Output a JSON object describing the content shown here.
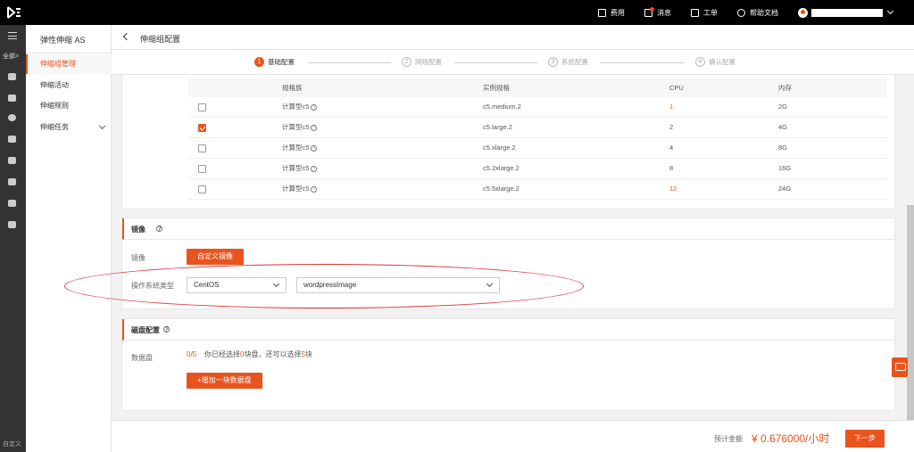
{
  "topbar": {
    "items": [
      {
        "label": "费用",
        "icon": "fee-icon"
      },
      {
        "label": "消息",
        "icon": "message-icon"
      },
      {
        "label": "工单",
        "icon": "ticket-icon"
      },
      {
        "label": "帮助文档",
        "icon": "help-icon"
      }
    ]
  },
  "rail": {
    "all_label": "全部",
    "custom_label": "自定义"
  },
  "subnav": {
    "title": "弹性伸缩 AS",
    "items": [
      {
        "label": "伸缩组管理"
      },
      {
        "label": "伸缩活动"
      },
      {
        "label": "伸缩规则"
      },
      {
        "label": "伸缩任务"
      }
    ]
  },
  "header": {
    "title": "伸缩组配置"
  },
  "steps": [
    {
      "num": "1",
      "label": "基础配置"
    },
    {
      "num": "2",
      "label": "网络配置"
    },
    {
      "num": "3",
      "label": "系统配置"
    },
    {
      "num": "4",
      "label": "确认配置"
    }
  ],
  "spec_table": {
    "headers": [
      "规格族",
      "实例规格",
      "CPU",
      "内存"
    ],
    "rows": [
      {
        "family": "计算型c5",
        "spec": "c5.medium.2",
        "cpu": "1",
        "mem": "2G",
        "checked": false
      },
      {
        "family": "计算型c5",
        "spec": "c5.large.2",
        "cpu": "2",
        "mem": "4G",
        "checked": true
      },
      {
        "family": "计算型c5",
        "spec": "c5.xlarge.2",
        "cpu": "4",
        "mem": "8G",
        "checked": false
      },
      {
        "family": "计算型c5",
        "spec": "c5.2xlarge.2",
        "cpu": "8",
        "mem": "16G",
        "checked": false
      },
      {
        "family": "计算型c5",
        "spec": "c5.5xlarge.2",
        "cpu": "12",
        "mem": "24G",
        "checked": false
      }
    ]
  },
  "image_section": {
    "title": "镜像",
    "image_label": "镜像",
    "custom_image_button": "自定义镜像",
    "os_type_label": "操作系统类型",
    "os_select": "CentOS",
    "image_select": "wordpressImage"
  },
  "disk_section": {
    "title": "磁盘配置",
    "data_disk_label": "数据盘",
    "count": "0/5",
    "info_prefix": "你已经选择",
    "selected": "0",
    "info_mid": "块盘，还可以选择",
    "remaining": "5",
    "info_suffix": "块",
    "add_button": "+增加一块数据盘"
  },
  "footer": {
    "cost_label": "预计金额",
    "price": "¥ 0.676000/小时",
    "next_button": "下一步"
  },
  "colors": {
    "accent": "#e8541e",
    "highlight": "#d8363b"
  }
}
